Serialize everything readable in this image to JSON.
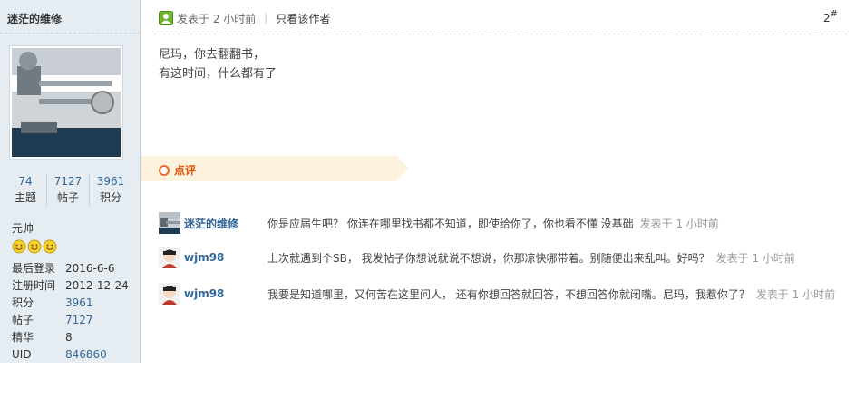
{
  "author": {
    "name": "迷茫的维修",
    "stats": [
      {
        "value": "74",
        "label": "主题"
      },
      {
        "value": "7127",
        "label": "帖子"
      },
      {
        "value": "3961",
        "label": "积分"
      }
    ],
    "rank": "元帅",
    "details": [
      {
        "key": "最后登录",
        "value": "2016-6-6"
      },
      {
        "key": "注册时间",
        "value": "2012-12-24"
      },
      {
        "key": "积分",
        "value": "3961"
      },
      {
        "key": "帖子",
        "value": "7127"
      },
      {
        "key": "精华",
        "value": "8"
      },
      {
        "key": "UID",
        "value": "846860"
      }
    ]
  },
  "post": {
    "posted_at": "发表于 2 小时前",
    "separator": "|",
    "only_author": "只看该作者",
    "floor_number": "2",
    "floor_mark": "#",
    "body_lines": [
      "尼玛，你去翻翻书，",
      "有这时间，什么都有了"
    ]
  },
  "comments_section": {
    "label": "点评",
    "items": [
      {
        "user": "迷茫的维修",
        "text": "你是应届生吧？ 你连在哪里找书都不知道，即使给你了，你也看不懂 没基础",
        "time": "发表于 1 小时前"
      },
      {
        "user": "wjm98",
        "text": "上次就遇到个SB， 我发帖子你想说就说不想说，你那凉快哪带着。别随便出来乱叫。好吗？",
        "time": "发表于 1 小时前"
      },
      {
        "user": "wjm98",
        "text": "我要是知道哪里，又何苦在这里问人， 还有你想回答就回答，不想回答你就闭嘴。尼玛，我惹你了？",
        "time": "发表于 1 小时前"
      }
    ]
  },
  "colors": {
    "sidebar_bg": "#e5edf2",
    "link": "#336699",
    "comment_bar": "#fdf2de",
    "comment_label": "#dd5500"
  }
}
